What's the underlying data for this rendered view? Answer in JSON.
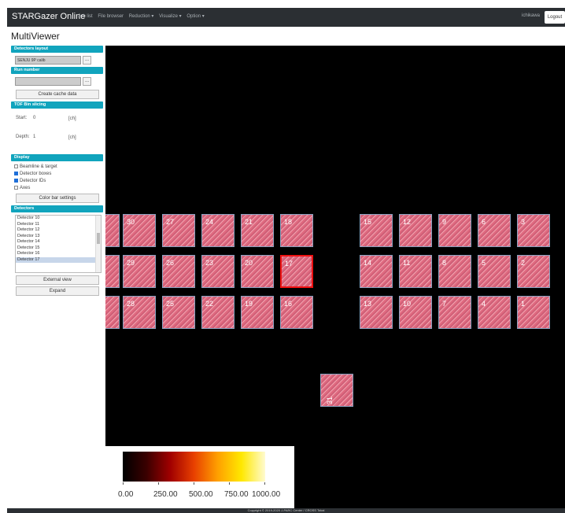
{
  "navbar": {
    "brand": "STARGazer Online",
    "links": [
      "Job list",
      "File browser",
      "Reduction ▾",
      "Visualize ▾",
      "Option ▾"
    ],
    "user": "ichikawa",
    "logout": "Logout"
  },
  "page_title": "MultiViewer",
  "sidebar": {
    "detector_layout": {
      "header": "Detectors layout",
      "value": "SENJU 9P calib",
      "button": "..."
    },
    "run_number": {
      "header": "Run number",
      "value": "",
      "button": "...",
      "cache_button": "Create cache data"
    },
    "tof_slicing": {
      "header": "TOF Bin slicing",
      "start_label": "Start:",
      "start_value": "0",
      "start_unit": "[ch]",
      "depth_label": "Depth:",
      "depth_value": "1",
      "depth_unit": "[ch]"
    },
    "display": {
      "header": "Display",
      "options": [
        {
          "label": "Beamline & target",
          "checked": false
        },
        {
          "label": "Detector boxes",
          "checked": true
        },
        {
          "label": "Detector IDs",
          "checked": true
        },
        {
          "label": "Axes",
          "checked": false
        }
      ],
      "colorbar_button": "Color bar settings"
    },
    "detectors": {
      "header": "Detectors",
      "items": [
        "Detector 10",
        "Detector 11",
        "Detector 12",
        "Detector 13",
        "Detector 14",
        "Detector 15",
        "Detector 16",
        "Detector 17"
      ],
      "selected": "Detector 17",
      "external_view_button": "External view",
      "expand_button": "Expand"
    }
  },
  "viewer": {
    "detectors": [
      {
        "id": "30"
      },
      {
        "id": "27"
      },
      {
        "id": "24"
      },
      {
        "id": "21"
      },
      {
        "id": "18"
      },
      {
        "id": "15"
      },
      {
        "id": "12"
      },
      {
        "id": "9"
      },
      {
        "id": "6"
      },
      {
        "id": "3"
      },
      {
        "id": "29"
      },
      {
        "id": "26"
      },
      {
        "id": "23"
      },
      {
        "id": "20"
      },
      {
        "id": "17"
      },
      {
        "id": "14"
      },
      {
        "id": "11"
      },
      {
        "id": "8"
      },
      {
        "id": "5"
      },
      {
        "id": "2"
      },
      {
        "id": "28"
      },
      {
        "id": "25"
      },
      {
        "id": "22"
      },
      {
        "id": "19"
      },
      {
        "id": "16"
      },
      {
        "id": "13"
      },
      {
        "id": "10"
      },
      {
        "id": "7"
      },
      {
        "id": "4"
      },
      {
        "id": "1"
      },
      {
        "id": "31"
      }
    ],
    "selected_detector": "17",
    "colorbar": {
      "labels": [
        "0.00",
        "250.00",
        "500.00",
        "750.00",
        "1000.00"
      ]
    }
  },
  "footer": "Copyright © 2019-2020 J-PARC Center / CROSS Tokai"
}
